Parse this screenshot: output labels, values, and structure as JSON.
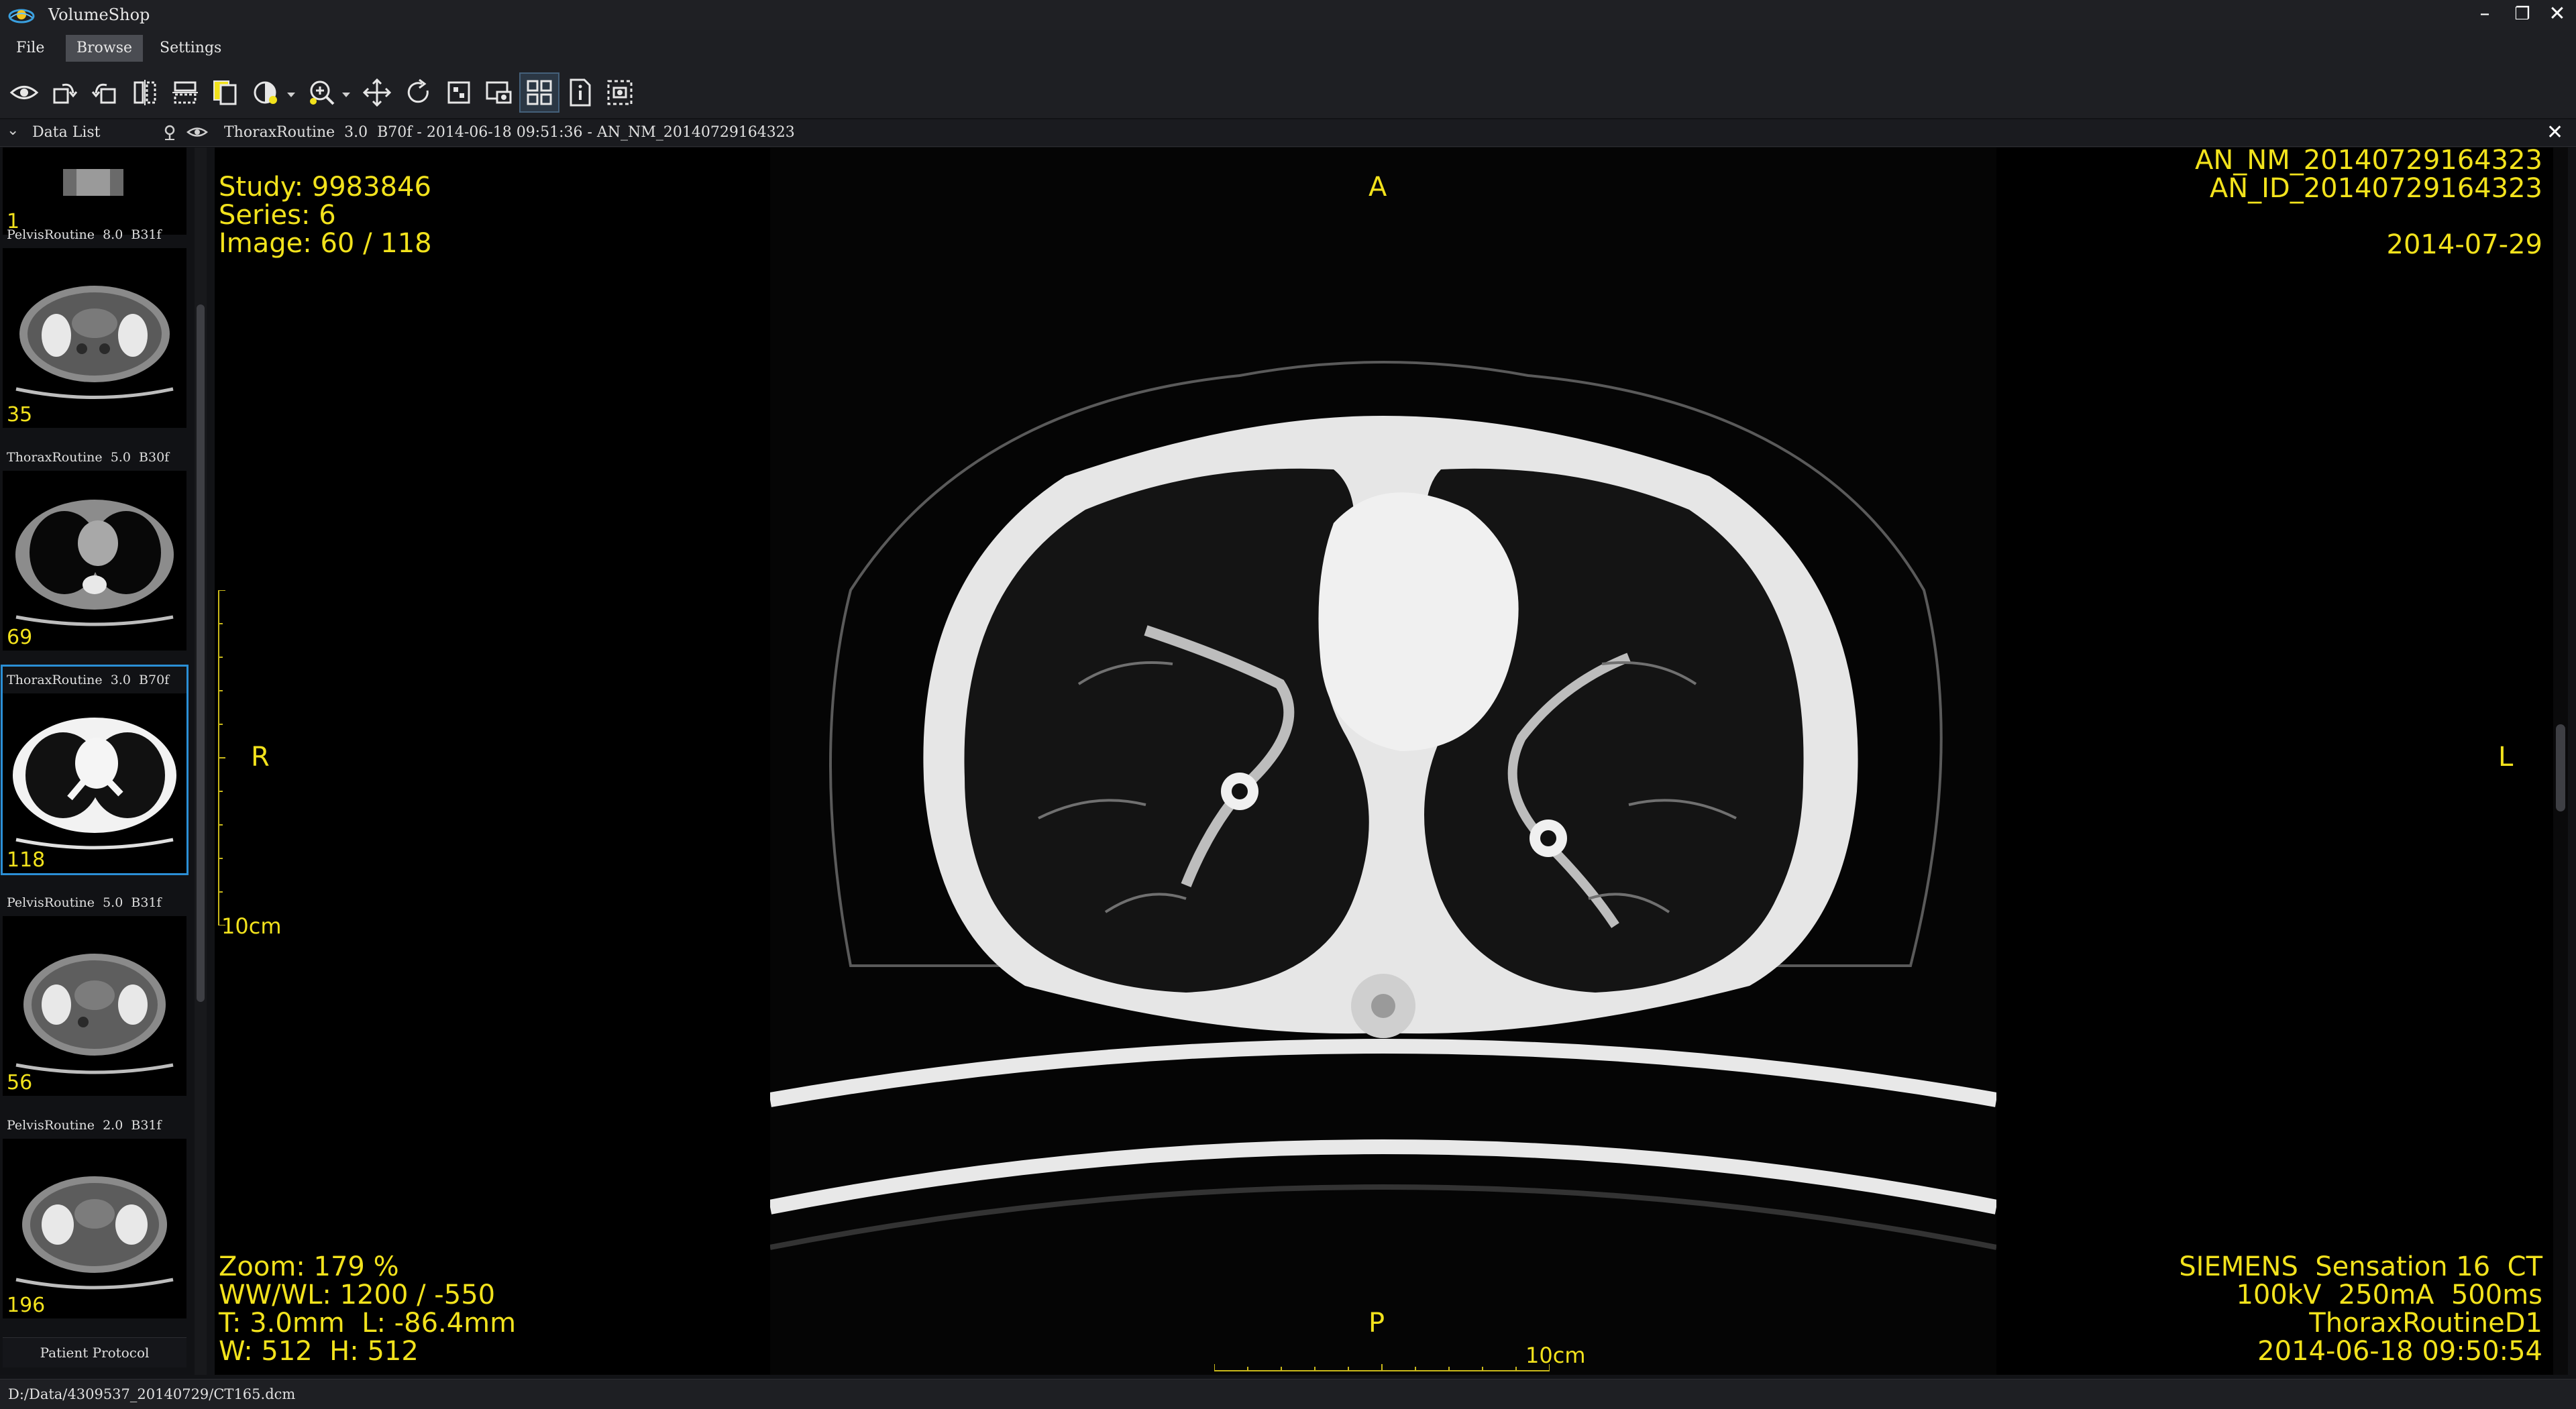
{
  "window": {
    "title": "VolumeShop"
  },
  "menu": {
    "file": "File",
    "browse": "Browse",
    "settings": "Settings"
  },
  "toolbar": {
    "tools": [
      {
        "name": "eye-icon"
      },
      {
        "name": "rotate-cw-icon"
      },
      {
        "name": "rotate-ccw-icon"
      },
      {
        "name": "flip-horizontal-icon"
      },
      {
        "name": "flip-vertical-icon"
      },
      {
        "name": "copy-icon"
      },
      {
        "name": "window-level-icon"
      },
      {
        "name": "zoom-icon"
      },
      {
        "name": "pan-icon"
      },
      {
        "name": "reset-icon"
      },
      {
        "name": "fit-icon"
      },
      {
        "name": "compare-icon"
      },
      {
        "name": "layout-grid-icon"
      },
      {
        "name": "info-icon"
      },
      {
        "name": "screenshot-icon"
      }
    ]
  },
  "datalist": {
    "label": "Data List",
    "items": [
      {
        "title": "",
        "count": "1"
      },
      {
        "title": "PelvisRoutine  8.0  B31f",
        "count": "35"
      },
      {
        "title": "ThoraxRoutine  5.0  B30f",
        "count": "69"
      },
      {
        "title": "ThoraxRoutine  3.0  B70f",
        "count": "118"
      },
      {
        "title": "PelvisRoutine  5.0  B31f",
        "count": "56"
      },
      {
        "title": "PelvisRoutine  2.0  B31f",
        "count": "196"
      }
    ],
    "footer": "Patient Protocol"
  },
  "viewer": {
    "info": "ThoraxRoutine  3.0  B70f - 2014-06-18 09:51:36 - AN_NM_20140729164323",
    "overlay": {
      "top_left": [
        "Study: 9983846",
        "Series: 6",
        "Image: 60 / 118"
      ],
      "top_right": [
        "AN_NM_20140729164323",
        "AN_ID_20140729164323",
        "2014-07-29"
      ],
      "bottom_left": [
        "Zoom: 179 %",
        "WW/WL: 1200 / -550",
        "T: 3.0mm  L: -86.4mm",
        "W: 512  H: 512"
      ],
      "bottom_right": [
        "SIEMENS  Sensation 16  CT",
        "100kV  250mA  500ms",
        "ThoraxRoutineD1",
        "2014-06-18 09:50:54"
      ],
      "orient_top": "A",
      "orient_bottom": "P",
      "orient_left": "R",
      "orient_right": "L",
      "scale_vertical": "10cm",
      "scale_horizontal": "10cm"
    }
  },
  "status": {
    "path": "D:/Data/4309537_20140729/CT165.dcm"
  },
  "colors": {
    "overlay": "#f2e21c",
    "selection": "#2b8fd6",
    "background": "#121316"
  }
}
